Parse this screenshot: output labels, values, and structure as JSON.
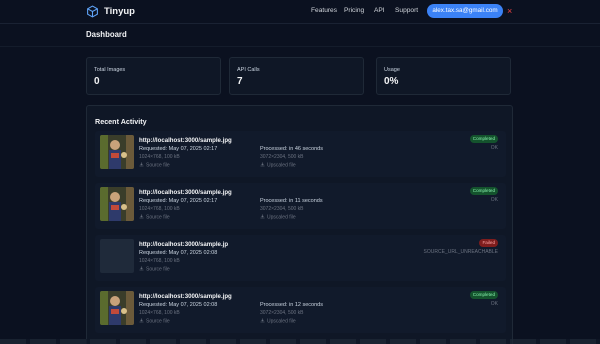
{
  "brand": {
    "name": "Tinyup",
    "accent": "#3b82f6"
  },
  "nav": {
    "features": "Features",
    "pricing": "Pricing",
    "api": "API",
    "support": "Support"
  },
  "user": {
    "email": "alex.tax.sa@gmail.com",
    "close_icon": "×"
  },
  "page": {
    "title": "Dashboard"
  },
  "stats": [
    {
      "label": "Total Images",
      "value": "0"
    },
    {
      "label": "API Calls",
      "value": "7"
    },
    {
      "label": "Usage",
      "value": "0%"
    }
  ],
  "activity": {
    "title": "Recent Activity",
    "items": [
      {
        "url": "http://localhost:3000/sample.jpg",
        "requested": "Requested: May 07, 2025 02:17",
        "src_meta": "1024×768, 100 kB",
        "source_link": "Source file",
        "processed": "Processed: in 46 seconds",
        "out_meta": "3072×2304, 500 kB",
        "upscaled_link": "Upscaled file",
        "status": "Completed",
        "result": "OK"
      },
      {
        "url": "http://localhost:3000/sample.jpg",
        "requested": "Requested: May 07, 2025 02:17",
        "src_meta": "1024×768, 100 kB",
        "source_link": "Source file",
        "processed": "Processed: in 11 seconds",
        "out_meta": "3072×2304, 500 kB",
        "upscaled_link": "Upscaled file",
        "status": "Completed",
        "result": "OK"
      },
      {
        "url": "http://localhost:3000/sample.jp",
        "requested": "Requested: May 07, 2025 02:08",
        "src_meta": "1024×768, 100 kB",
        "source_link": "Source file",
        "status": "Failed",
        "result": "SOURCE_URL_UNREACHABLE"
      },
      {
        "url": "http://localhost:3000/sample.jpg",
        "requested": "Requested: May 07, 2025 02:08",
        "src_meta": "1024×768, 100 kB",
        "source_link": "Source file",
        "processed": "Processed: in 12 seconds",
        "out_meta": "3072×2304, 500 kB",
        "upscaled_link": "Upscaled file",
        "status": "Completed",
        "result": "OK"
      }
    ]
  }
}
